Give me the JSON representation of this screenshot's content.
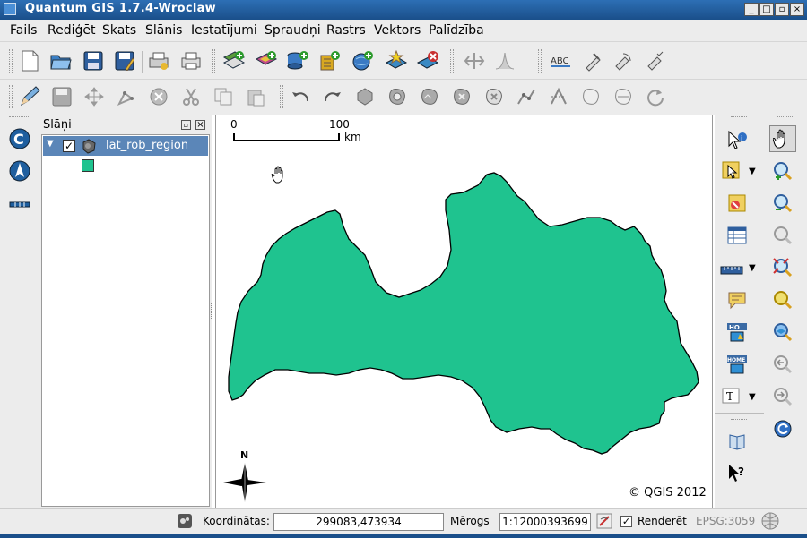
{
  "window": {
    "title": "Quantum GIS 1.7.4-Wroclaw",
    "min": "_",
    "max": "□",
    "close": "×"
  },
  "menu": [
    "Fails",
    "Rediģēt",
    "Skats",
    "Slānis",
    "Iestatījumi",
    "Spraudņi",
    "Rastrs",
    "Vektors",
    "Palīdzība"
  ],
  "layers_panel": {
    "title": "Slāņi",
    "layer_name": "lat_rob_region",
    "layer_checked": true,
    "layer_color": "#1fc38f"
  },
  "map": {
    "scalebar_start": "0",
    "scalebar_end": "100",
    "scalebar_unit": "km",
    "copyright": "© QGIS 2012",
    "north_label": "N",
    "fill_color": "#1fc38f"
  },
  "status": {
    "coords_label": "Koordinātas:",
    "coords_value": "299083,473934",
    "scale_label": "Mērogs",
    "scale_value": "1:12000393699",
    "render_label": "Renderēt",
    "render_checked": true,
    "crs": "EPSG:3059"
  }
}
